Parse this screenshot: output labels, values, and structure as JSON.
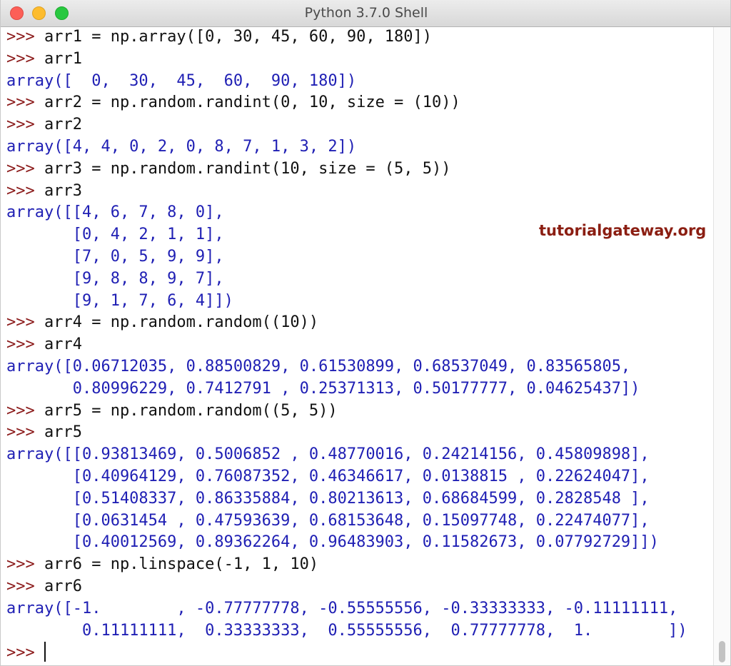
{
  "window": {
    "title": "Python 3.7.0 Shell"
  },
  "watermark": "tutorialgateway.org",
  "console": {
    "prompt": ">>> ",
    "lines": [
      {
        "type": "input",
        "text": "arr1 = np.array([0, 30, 45, 60, 90, 180])"
      },
      {
        "type": "input",
        "text": "arr1"
      },
      {
        "type": "output",
        "text": "array([  0,  30,  45,  60,  90, 180])"
      },
      {
        "type": "input",
        "text": "arr2 = np.random.randint(0, 10, size = (10))"
      },
      {
        "type": "input",
        "text": "arr2"
      },
      {
        "type": "output",
        "text": "array([4, 4, 0, 2, 0, 8, 7, 1, 3, 2])"
      },
      {
        "type": "input",
        "text": "arr3 = np.random.randint(10, size = (5, 5))"
      },
      {
        "type": "input",
        "text": "arr3"
      },
      {
        "type": "output",
        "text": "array([[4, 6, 7, 8, 0],"
      },
      {
        "type": "output",
        "text": "       [0, 4, 2, 1, 1],"
      },
      {
        "type": "output",
        "text": "       [7, 0, 5, 9, 9],"
      },
      {
        "type": "output",
        "text": "       [9, 8, 8, 9, 7],"
      },
      {
        "type": "output",
        "text": "       [9, 1, 7, 6, 4]])"
      },
      {
        "type": "input",
        "text": "arr4 = np.random.random((10))"
      },
      {
        "type": "input",
        "text": "arr4"
      },
      {
        "type": "output",
        "text": "array([0.06712035, 0.88500829, 0.61530899, 0.68537049, 0.83565805,"
      },
      {
        "type": "output",
        "text": "       0.80996229, 0.7412791 , 0.25371313, 0.50177777, 0.04625437])"
      },
      {
        "type": "input",
        "text": "arr5 = np.random.random((5, 5))"
      },
      {
        "type": "input",
        "text": "arr5"
      },
      {
        "type": "output",
        "text": "array([[0.93813469, 0.5006852 , 0.48770016, 0.24214156, 0.45809898],"
      },
      {
        "type": "output",
        "text": "       [0.40964129, 0.76087352, 0.46346617, 0.0138815 , 0.22624047],"
      },
      {
        "type": "output",
        "text": "       [0.51408337, 0.86335884, 0.80213613, 0.68684599, 0.2828548 ],"
      },
      {
        "type": "output",
        "text": "       [0.0631454 , 0.47593639, 0.68153648, 0.15097748, 0.22474077],"
      },
      {
        "type": "output",
        "text": "       [0.40012569, 0.89362264, 0.96483903, 0.11582673, 0.07792729]])"
      },
      {
        "type": "input",
        "text": "arr6 = np.linspace(-1, 1, 10)"
      },
      {
        "type": "input",
        "text": "arr6"
      },
      {
        "type": "output",
        "text": "array([-1.        , -0.77777778, -0.55555556, -0.33333333, -0.11111111,"
      },
      {
        "type": "output",
        "text": "        0.11111111,  0.33333333,  0.55555556,  0.77777778,  1.        ])"
      },
      {
        "type": "prompt-only",
        "text": ""
      }
    ]
  },
  "colors": {
    "prompt": "#8b1a1a",
    "command": "#111111",
    "output": "#1f1fb4",
    "watermark": "#8b1e12",
    "close": "#fc5f57",
    "minimize": "#fdbc2e",
    "maximize": "#28c840"
  }
}
